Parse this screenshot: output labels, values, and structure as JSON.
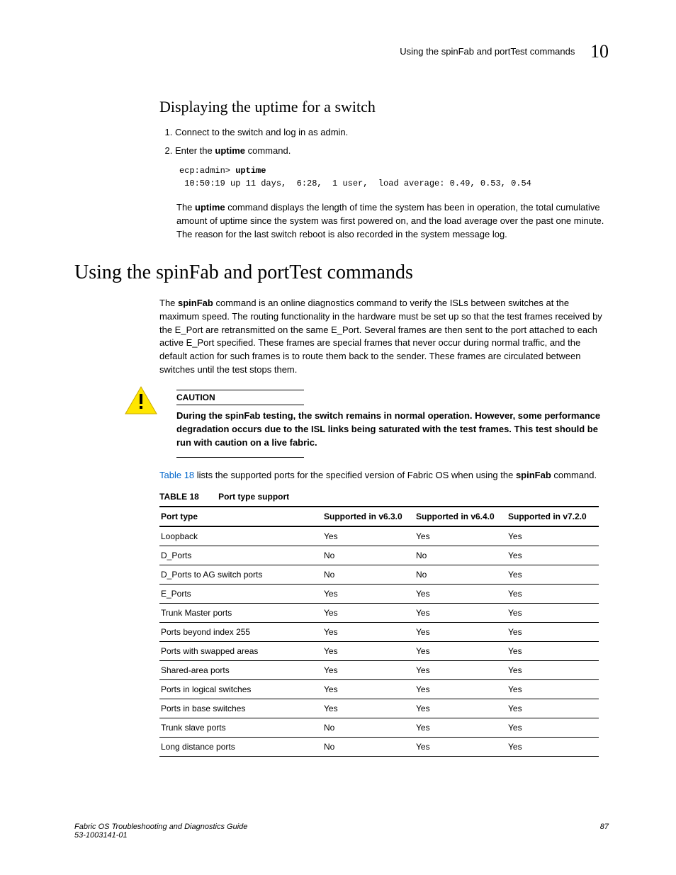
{
  "header": {
    "running_title": "Using the spinFab and portTest commands",
    "section_number": "10"
  },
  "section1": {
    "heading": "Displaying the uptime for a switch",
    "steps": [
      "Connect to the switch and log in as admin.",
      "Enter the uptime command."
    ],
    "step2_pre": "Enter the ",
    "step2_cmd": "uptime",
    "step2_post": " command.",
    "code_prompt": "ecp:admin> ",
    "code_cmd": "uptime",
    "code_output": " 10:50:19 up 11 days,  6:28,  1 user,  load average: 0.49, 0.53, 0.54",
    "explain_pre": "The ",
    "explain_cmd": "uptime",
    "explain_post": " command displays the length of time the system has been in operation, the total cumulative amount of uptime since the system was first powered on, and the load average over the past one minute. The reason for the last switch reboot is also recorded in the system message log."
  },
  "section2": {
    "heading": "Using the spinFab and portTest commands",
    "para1_pre": "The ",
    "para1_cmd": "spinFab",
    "para1_post": " command is an online diagnostics command to verify the ISLs between switches at the maximum speed. The routing functionality in the hardware must be set up so that the test frames received by the E_Port are retransmitted on the same E_Port. Several frames are then sent to the port attached to each active E_Port specified. These frames are special frames that never occur during normal traffic, and the default action for such frames is to route them back to the sender. These frames are circulated between switches until the test stops them.",
    "caution_label": "CAUTION",
    "caution_text": "During the spinFab testing, the switch remains in normal operation. However, some performance degradation occurs due to the ISL links being saturated with the test frames. This test should be run with caution on a live fabric.",
    "para2_link": "Table 18",
    "para2_mid": " lists the supported ports for the specified version of Fabric OS when using the ",
    "para2_cmd": "spinFab",
    "para2_post": " command.",
    "table_number": "TABLE 18",
    "table_title": "Port type support",
    "table_headers": [
      "Port type",
      "Supported in v6.3.0",
      "Supported in v6.4.0",
      "Supported in v7.2.0"
    ],
    "table_rows": [
      [
        "Loopback",
        "Yes",
        "Yes",
        "Yes"
      ],
      [
        "D_Ports",
        "No",
        "No",
        "Yes"
      ],
      [
        "D_Ports to AG switch ports",
        "No",
        "No",
        "Yes"
      ],
      [
        "E_Ports",
        "Yes",
        "Yes",
        "Yes"
      ],
      [
        "Trunk Master ports",
        "Yes",
        "Yes",
        "Yes"
      ],
      [
        "Ports beyond index 255",
        "Yes",
        "Yes",
        "Yes"
      ],
      [
        "Ports with swapped areas",
        "Yes",
        "Yes",
        "Yes"
      ],
      [
        "Shared-area ports",
        "Yes",
        "Yes",
        "Yes"
      ],
      [
        "Ports in logical switches",
        "Yes",
        "Yes",
        "Yes"
      ],
      [
        "Ports in base switches",
        "Yes",
        "Yes",
        "Yes"
      ],
      [
        "Trunk slave ports",
        "No",
        "Yes",
        "Yes"
      ],
      [
        "Long distance ports",
        "No",
        "Yes",
        "Yes"
      ]
    ]
  },
  "footer": {
    "line1": "Fabric OS Troubleshooting and Diagnostics Guide",
    "line2": "53-1003141-01",
    "page": "87"
  }
}
